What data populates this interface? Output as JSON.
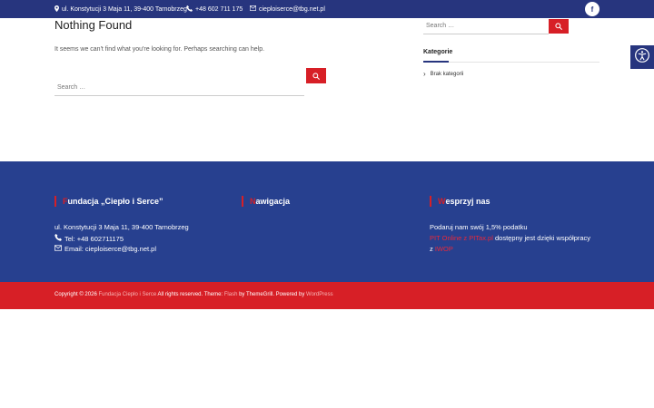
{
  "topbar": {
    "address": "ul. Konstytucji 3 Maja 11, 39-400 Tarnobrzeg",
    "phone": "+48 602 711 175",
    "email": "cieploiserce@tbg.net.pl",
    "facebook_glyph": "f"
  },
  "accessibility": {
    "icon": "accessibility-icon"
  },
  "main": {
    "title": "Nothing Found",
    "message": "It seems we can't find what you're looking for. Perhaps searching can help.",
    "search_placeholder": "Search …"
  },
  "sidebar": {
    "search_placeholder": "Search …",
    "categories_heading": "Kategorie",
    "categories": [
      {
        "label": "Brak kategorii"
      }
    ]
  },
  "footer": {
    "col1": {
      "heading_first": "F",
      "heading_rest": "undacja „Ciepło i Serce”",
      "address": "ul. Konstytucji 3 Maja 11, 39-400 Tarnobrzeg",
      "phone": "Tel: +48 602711175",
      "email": "Email: cieploiserce@tbg.net.pl"
    },
    "col2": {
      "heading_first": "N",
      "heading_rest": "awigacja"
    },
    "col3": {
      "heading_first": "W",
      "heading_rest": "esprzyj nas",
      "line1": "Podaruj nam swój 1,5% podatku",
      "line2_link": "PIT Online z PITax.pl",
      "line2_rest": " dostępny jest dzięki współpracy",
      "line3_prefix": "z ",
      "line3_link": "IWOP"
    }
  },
  "copyright": {
    "prefix": "Copyright © 2026 ",
    "site_link": "Fundacja Ciepło i Serce",
    "middle": " All rights reserved. Theme: ",
    "theme_link": "Flash",
    "by": " by ThemeGrill. Powered by ",
    "wp_link": "WordPress"
  },
  "colors": {
    "navy": "#27357e",
    "footer_blue": "#27408f",
    "accent_red": "#d71f26"
  }
}
